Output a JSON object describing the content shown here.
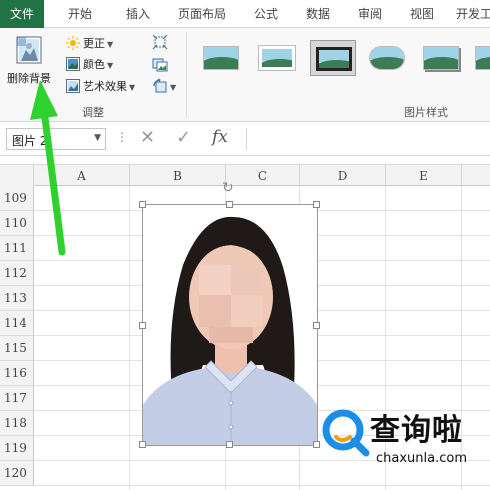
{
  "tabs": [
    {
      "label": "文件",
      "active": true
    },
    {
      "label": "开始",
      "active": false
    },
    {
      "label": "插入",
      "active": false
    },
    {
      "label": "页面布局",
      "active": false
    },
    {
      "label": "公式",
      "active": false
    },
    {
      "label": "数据",
      "active": false
    },
    {
      "label": "审阅",
      "active": false
    },
    {
      "label": "视图",
      "active": false
    },
    {
      "label": "开发工",
      "active": false
    }
  ],
  "ribbon": {
    "remove_background_label": "删除背景",
    "correct_label": "更正",
    "color_label": "颜色",
    "artistic_label": "艺术效果",
    "adjust_group_label": "调整",
    "picture_styles_group_label": "图片样式",
    "picture_styles": [
      {
        "name": "simple-frame-style",
        "selected": false
      },
      {
        "name": "white-frame-style",
        "selected": false
      },
      {
        "name": "gray-frame-style",
        "selected": true
      },
      {
        "name": "oval-style",
        "selected": false
      },
      {
        "name": "shadow-style",
        "selected": false
      },
      {
        "name": "reflection-style",
        "selected": false
      }
    ]
  },
  "formula_bar": {
    "name_box": "图片 2",
    "fx_label": "fx",
    "value": ""
  },
  "sheet": {
    "columns": [
      "A",
      "B",
      "C",
      "D",
      "E"
    ],
    "rows": [
      "109",
      "110",
      "111",
      "112",
      "113",
      "114",
      "115",
      "116",
      "117",
      "118",
      "119",
      "120"
    ]
  },
  "watermark": {
    "title": "查询啦",
    "url": "chaxunla.com"
  },
  "colors": {
    "file_tab_bg": "#217346",
    "arrow_green": "#2fd12f",
    "watermark_blue": "#1c8ee8",
    "watermark_orange": "#f39c12"
  }
}
